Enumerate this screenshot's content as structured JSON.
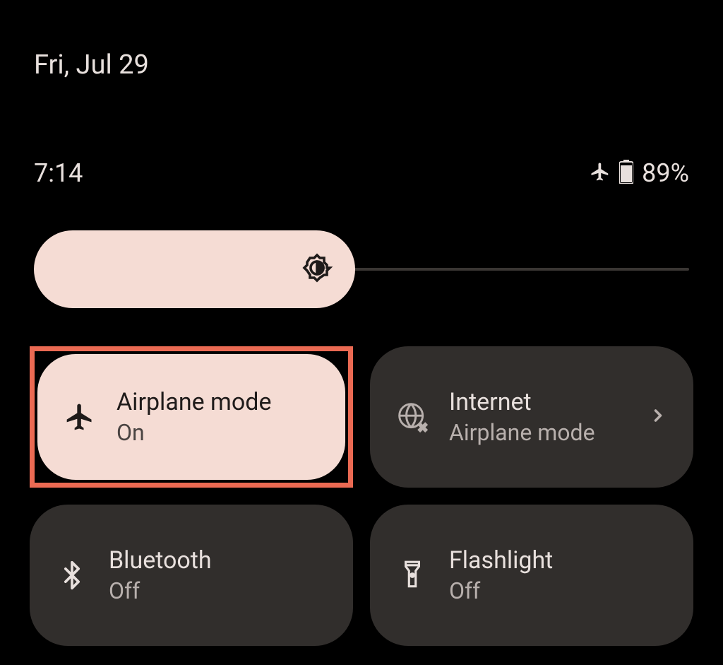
{
  "date": "Fri, Jul 29",
  "time": "7:14",
  "battery": "89%",
  "brightness": {
    "level": 49
  },
  "tiles": {
    "airplane": {
      "title": "Airplane mode",
      "subtitle": "On"
    },
    "internet": {
      "title": "Internet",
      "subtitle": "Airplane mode"
    },
    "bluetooth": {
      "title": "Bluetooth",
      "subtitle": "Off"
    },
    "flashlight": {
      "title": "Flashlight",
      "subtitle": "Off"
    }
  }
}
